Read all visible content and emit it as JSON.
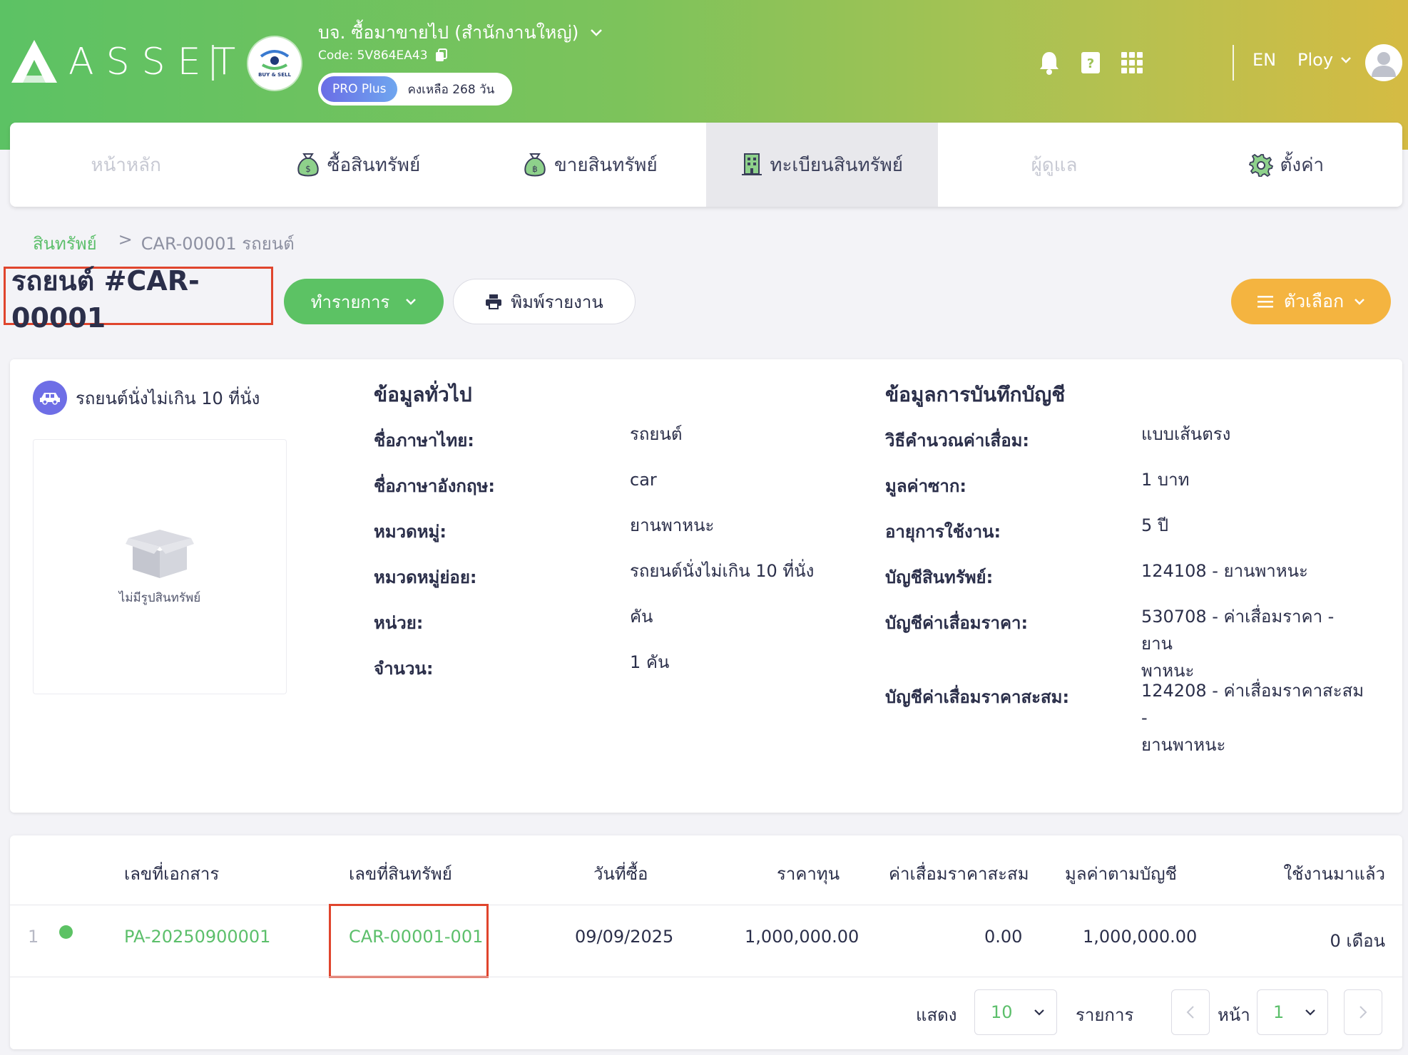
{
  "header": {
    "logo_text": "ASSET",
    "company_name": "บจ. ซื้อมาขายไป (สำนักงานใหญ่)",
    "company_logo_text": "BUY & SELL",
    "company_code": "Code: 5V864EA43",
    "plan_name": "PRO Plus",
    "plan_remaining": "คงเหลือ 268 วัน",
    "language": "EN",
    "username": "Ploy",
    "icons": [
      "bell-icon",
      "help-book-icon",
      "apps-grid-icon",
      "user-avatar-icon"
    ]
  },
  "nav": {
    "tabs": [
      {
        "label": "หน้าหลัก",
        "icon": "",
        "state": "disabled"
      },
      {
        "label": "ซื้อสินทรัพย์",
        "icon": "money-bag-icon",
        "state": "normal"
      },
      {
        "label": "ขายสินทรัพย์",
        "icon": "money-bag-icon",
        "state": "normal"
      },
      {
        "label": "ทะเบียนสินทรัพย์",
        "icon": "building-icon",
        "state": "active"
      },
      {
        "label": "ผู้ดูแล",
        "icon": "",
        "state": "disabled"
      },
      {
        "label": "ตั้งค่า",
        "icon": "gear-icon",
        "state": "normal"
      }
    ]
  },
  "breadcrumb": {
    "root": "สินทรัพย์",
    "separator": ">",
    "current": "CAR-00001 รถยนต์"
  },
  "page": {
    "title": "รถยนต์ #CAR-00001",
    "action_button": "ทำรายการ",
    "print_button": "พิมพ์รายงาน",
    "options_button": "ตัวเลือก"
  },
  "asset": {
    "category": "รถยนต์นั่งไม่เกิน 10 ที่นั่ง",
    "no_image_text": "ไม่มีรูปสินทรัพย์",
    "general": {
      "title": "ข้อมูลทั่วไป",
      "fields": [
        {
          "label": "ชื่อภาษาไทย:",
          "value": "รถยนต์"
        },
        {
          "label": "ชื่อภาษาอังกฤษ:",
          "value": "car"
        },
        {
          "label": "หมวดหมู่:",
          "value": "ยานพาหนะ"
        },
        {
          "label": "หมวดหมู่ย่อย:",
          "value": "รถยนต์นั่งไม่เกิน 10 ที่นั่ง"
        },
        {
          "label": "หน่วย:",
          "value": "คัน"
        },
        {
          "label": "จำนวน:",
          "value": "1 คัน"
        }
      ]
    },
    "accounting": {
      "title": "ข้อมูลการบันทึกบัญชี",
      "fields": [
        {
          "label": "วิธีคำนวณค่าเสื่อม:",
          "value": "แบบเส้นตรง"
        },
        {
          "label": "มูลค่าซาก:",
          "value": "1 บาท"
        },
        {
          "label": "อายุการใช้งาน:",
          "value": "5 ปี"
        },
        {
          "label": "บัญชีสินทรัพย์:",
          "value": "124108 - ยานพาหนะ"
        },
        {
          "label": "บัญชีค่าเสื่อมราคา:",
          "value": "530708 - ค่าเสื่อมราคา - ยาน\nพาหนะ"
        },
        {
          "label": "บัญชีค่าเสื่อมราคาสะสม:",
          "value": "124208 - ค่าเสื่อมราคาสะสม -\nยานพาหนะ"
        }
      ]
    }
  },
  "table": {
    "columns": [
      "เลขที่เอกสาร",
      "เลขที่สินทรัพย์",
      "วันที่ซื้อ",
      "ราคาทุน",
      "ค่าเสื่อมราคาสะสม",
      "มูลค่าตามบัญชี",
      "ใช้งานมาแล้ว"
    ],
    "rows": [
      {
        "index": "1",
        "status_color": "#5cc264",
        "doc_no": "PA-20250900001",
        "asset_no": "CAR-00001-001",
        "purchase_date": "09/09/2025",
        "cost": "1,000,000.00",
        "accum_depreciation": "0.00",
        "book_value": "1,000,000.00",
        "used": "0 เดือน"
      }
    ]
  },
  "pagination": {
    "show_label": "แสดง",
    "page_size": "10",
    "items_label": "รายการ",
    "page_label": "หน้า",
    "page": "1"
  },
  "colors": {
    "accent_green": "#5cc264",
    "accent_orange": "#f4b440",
    "highlight_red": "#e0452d",
    "plan_badge": "#6a6de6"
  }
}
